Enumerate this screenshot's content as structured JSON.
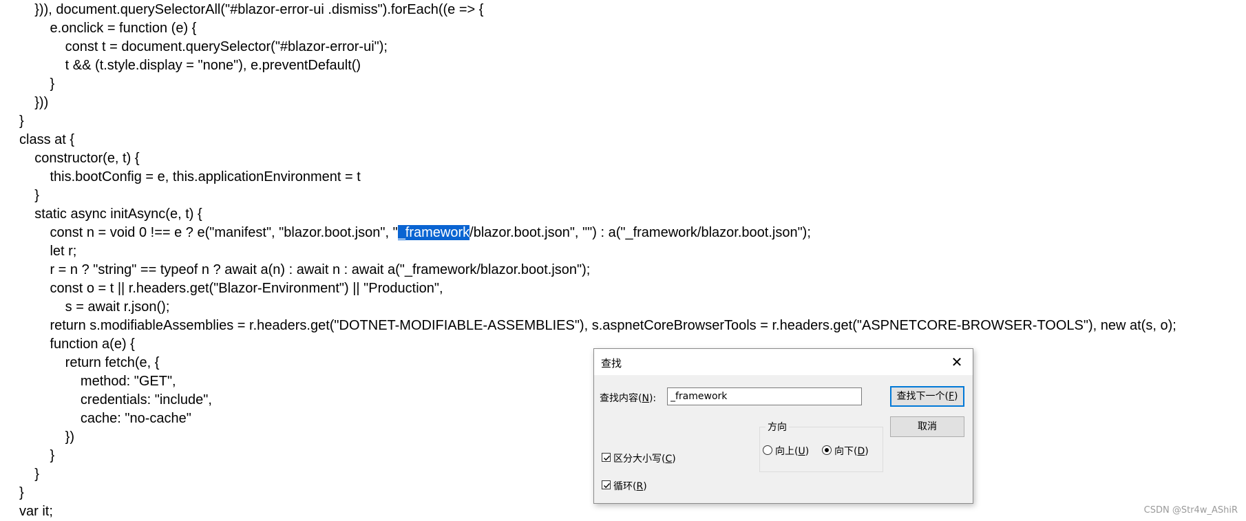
{
  "code": {
    "lines": [
      "    })), document.querySelectorAll(\"#blazor-error-ui .dismiss\").forEach((e => {",
      "        e.onclick = function (e) {",
      "            const t = document.querySelector(\"#blazor-error-ui\");",
      "            t && (t.style.display = \"none\"), e.preventDefault()",
      "        }",
      "    }))",
      "}",
      "class at {",
      "    constructor(e, t) {",
      "        this.bootConfig = e, this.applicationEnvironment = t",
      "    }",
      "    static async initAsync(e, t) {",
      {
        "before": "        const n = void 0 !== e ? e(\"manifest\", \"blazor.boot.json\", \"",
        "highlight": "_framework",
        "after": "/blazor.boot.json\", \"\") : a(\"_framework/blazor.boot.json\");"
      },
      "        let r;",
      "        r = n ? \"string\" == typeof n ? await a(n) : await n : await a(\"_framework/blazor.boot.json\");",
      "        const o = t || r.headers.get(\"Blazor-Environment\") || \"Production\",",
      "            s = await r.json();",
      "        return s.modifiableAssemblies = r.headers.get(\"DOTNET-MODIFIABLE-ASSEMBLIES\"), s.aspnetCoreBrowserTools = r.headers.get(\"ASPNETCORE-BROWSER-TOOLS\"), new at(s, o);",
      "        function a(e) {",
      "            return fetch(e, {",
      "                method: \"GET\",",
      "                credentials: \"include\",",
      "                cache: \"no-cache\"",
      "            })",
      "        }",
      "    }",
      "}",
      "var it;"
    ]
  },
  "find_dialog": {
    "title": "查找",
    "close_glyph": "✕",
    "find_label_prefix": "查找内容(",
    "find_label_key": "N",
    "find_label_suffix": "):",
    "find_value": "_framework",
    "find_next_prefix": "查找下一个(",
    "find_next_key": "F",
    "find_next_suffix": ")",
    "cancel_label": "取消",
    "direction_label": "方向",
    "up_prefix": "向上(",
    "up_key": "U",
    "up_suffix": ")",
    "down_prefix": "向下(",
    "down_key": "D",
    "down_suffix": ")",
    "direction_selected": "down",
    "match_case_prefix": "区分大小写(",
    "match_case_key": "C",
    "match_case_suffix": ")",
    "match_case_checked": true,
    "wrap_prefix": "循环(",
    "wrap_key": "R",
    "wrap_suffix": ")",
    "wrap_checked": true
  },
  "watermark": "CSDN @Str4w_AShiR",
  "colors": {
    "selection": "#0a64d2",
    "dialog_bg": "#f0f0f0",
    "default_button_border": "#0078d7"
  },
  "icons": {
    "close": "close-icon",
    "checkbox": "check-icon",
    "radio": "radio-dot-icon"
  }
}
